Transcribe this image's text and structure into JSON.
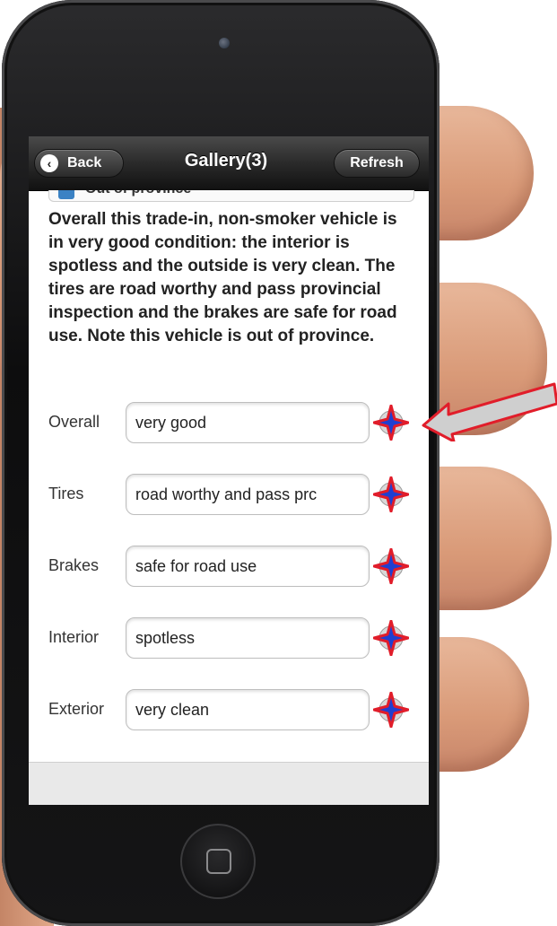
{
  "nav": {
    "back_label": "Back",
    "title": "Gallery(3)",
    "refresh_label": "Refresh"
  },
  "partial_item": {
    "label": "Out of province"
  },
  "description": "Overall this trade-in, non-smoker vehicle is in very good condition: the interior is spotless and the outside is very clean. The tires are road worthy and pass provincial inspection and the brakes are safe for road use. Note this vehicle is out of province.",
  "fields": [
    {
      "label": "Overall",
      "value": "very good"
    },
    {
      "label": "Tires",
      "value": "road worthy and pass prc"
    },
    {
      "label": "Brakes",
      "value": "safe for road use"
    },
    {
      "label": "Interior",
      "value": "spotless"
    },
    {
      "label": "Exterior",
      "value": "very clean"
    }
  ],
  "icons": {
    "back": "chevron-left-icon",
    "action": "star-sparkle-icon",
    "callout": "arrow-left-icon"
  },
  "colors": {
    "header": "#2a2a2a",
    "star_fill": "#1f3fd1",
    "star_outline": "#e11d2a",
    "arrow_fill": "#cfcfcf"
  }
}
